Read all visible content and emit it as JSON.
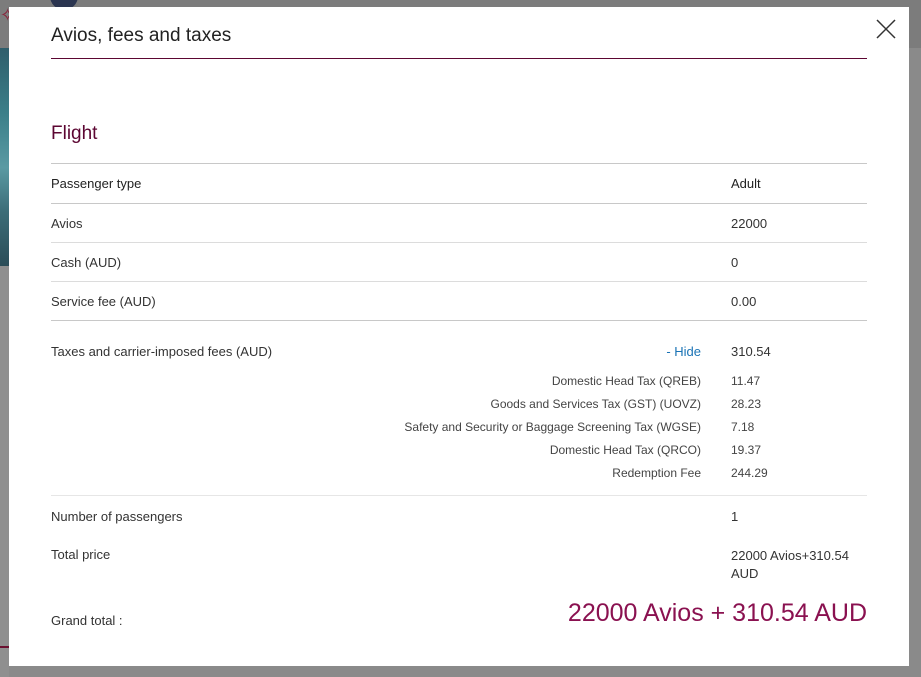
{
  "modal": {
    "title": "Avios, fees and taxes",
    "close_icon": "close-icon",
    "section_title": "Flight"
  },
  "table": {
    "header": {
      "label": "Passenger type",
      "value": "Adult"
    },
    "rows": [
      {
        "label": "Avios",
        "value": "22000"
      },
      {
        "label": "Cash (AUD)",
        "value": "0"
      },
      {
        "label": "Service fee (AUD)",
        "value": "0.00"
      }
    ],
    "taxes": {
      "label": "Taxes and carrier-imposed fees (AUD)",
      "toggle_label": "- Hide",
      "value": "310.54",
      "items": [
        {
          "name": "Domestic Head Tax (QREB)",
          "value": "11.47"
        },
        {
          "name": "Goods and Services Tax (GST) (UOVZ)",
          "value": "28.23"
        },
        {
          "name": "Safety and Security or Baggage Screening Tax (WGSE)",
          "value": "7.18"
        },
        {
          "name": "Domestic Head Tax (QRCO)",
          "value": "19.37"
        },
        {
          "name": "Redemption Fee",
          "value": "244.29"
        }
      ]
    },
    "passengers": {
      "label": "Number of passengers",
      "value": "1"
    },
    "total": {
      "label": "Total price",
      "value": "22000 Avios+310.54 AUD"
    },
    "grand_total": {
      "label": "Grand total :",
      "value": "22000 Avios + 310.54 AUD"
    }
  },
  "colors": {
    "brand": "#5c0632",
    "grand_total": "#8a1150",
    "link": "#1a73b5"
  }
}
